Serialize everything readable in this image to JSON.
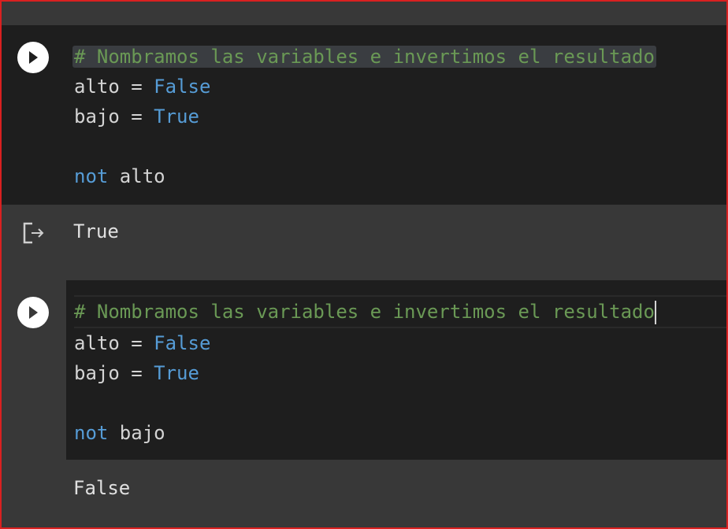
{
  "cell1": {
    "code": {
      "comment": "# Nombramos las variables e invertimos el resultado",
      "line2_var": "alto",
      "line2_op": " = ",
      "line2_val": "False",
      "line3_var": "bajo",
      "line3_op": " = ",
      "line3_val": "True",
      "line5_kw": "not",
      "line5_var": " alto"
    },
    "output": "True"
  },
  "cell2": {
    "code": {
      "comment": "# Nombramos las variables e invertimos el resultado",
      "line2_var": "alto",
      "line2_op": " = ",
      "line2_val": "False",
      "line3_var": "bajo",
      "line3_op": " = ",
      "line3_val": "True",
      "line5_kw": "not",
      "line5_var": " bajo"
    },
    "output": "False"
  },
  "icons": {
    "run": "play-icon",
    "output": "output-redirect-icon"
  },
  "colors": {
    "code_bg": "#1e1e1e",
    "comment": "#6a9955",
    "keyword": "#569cd6",
    "frame_border": "#d92020"
  }
}
